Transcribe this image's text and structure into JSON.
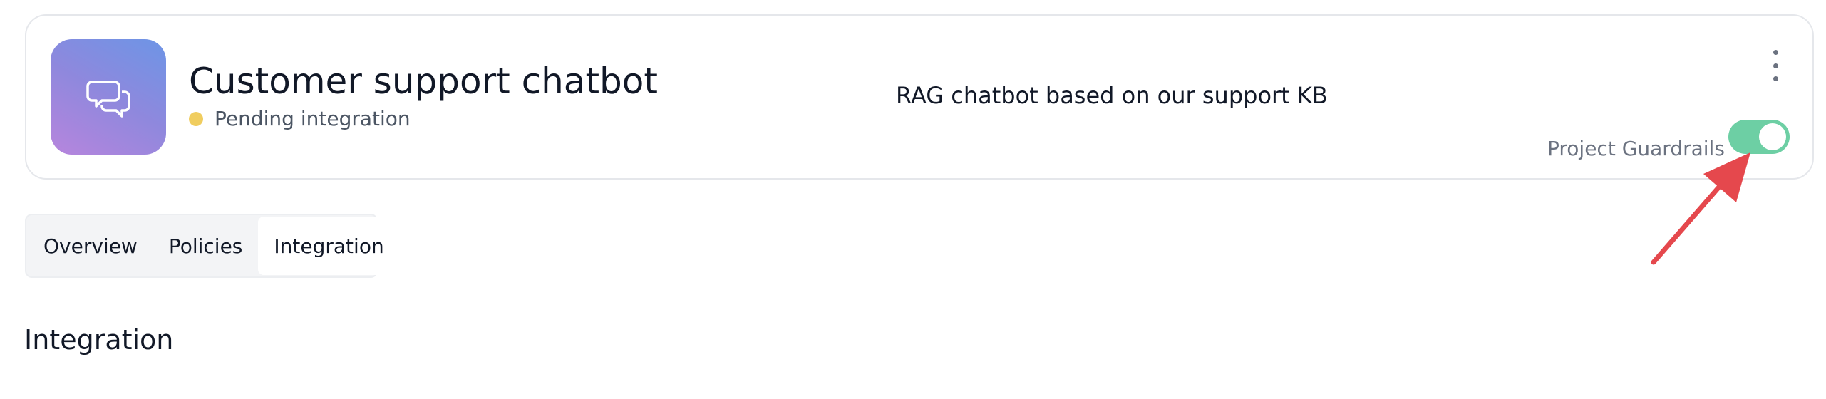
{
  "project": {
    "title": "Customer support chatbot",
    "status": "Pending integration",
    "status_color": "#f0cd5f",
    "description": "RAG chatbot based on our support KB",
    "icon": "chat-bubbles-icon",
    "icon_gradient": [
      "#6d95e6",
      "#b785dd"
    ],
    "guardrails_label": "Project Guardrails",
    "guardrails_enabled": true,
    "toggle_color": "#6dcfa4"
  },
  "tabs": [
    {
      "label": "Overview",
      "active": false
    },
    {
      "label": "Policies",
      "active": false
    },
    {
      "label": "Integration",
      "active": true
    }
  ],
  "section": {
    "title": "Integration"
  },
  "annotation": {
    "type": "arrow",
    "color": "#e5484d",
    "target": "guardrails-toggle"
  }
}
